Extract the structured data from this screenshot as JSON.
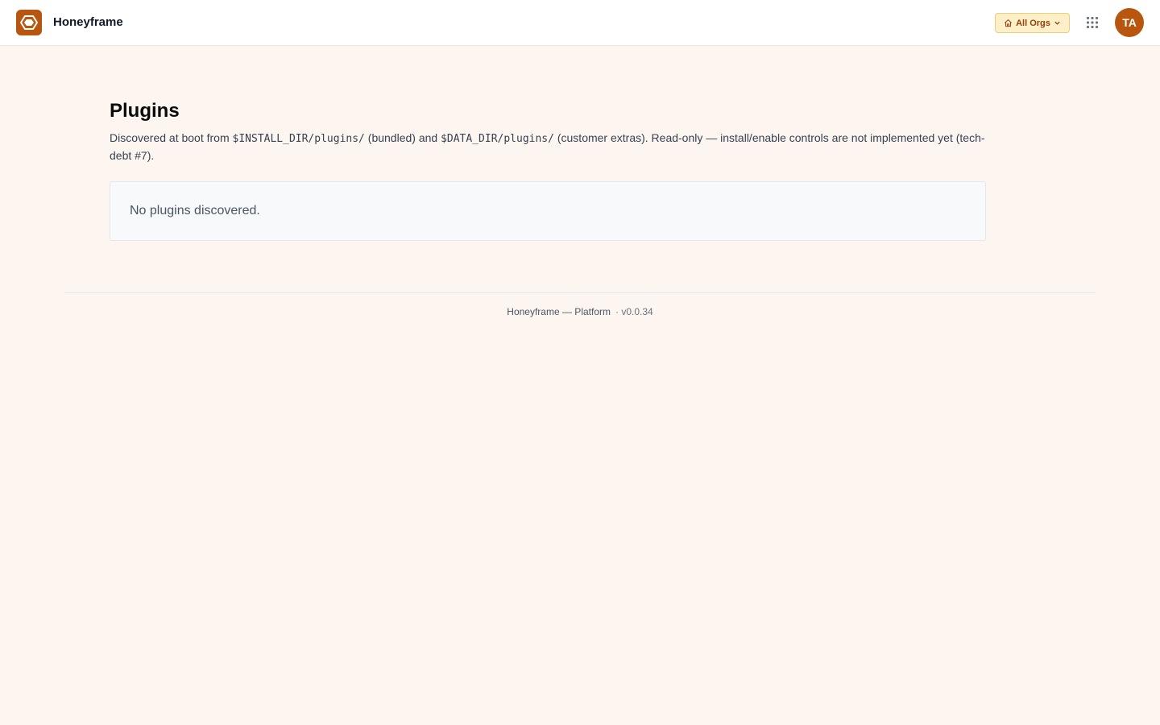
{
  "header": {
    "brand": "Honeyframe",
    "org_switcher": {
      "label": "All Orgs"
    },
    "avatar_initials": "TA"
  },
  "main": {
    "title": "Plugins",
    "description": {
      "part1": "Discovered at boot from ",
      "code1": "$INSTALL_DIR/plugins/",
      "part2": " (bundled) and ",
      "code2": "$DATA_DIR/plugins/",
      "part3": " (customer extras). Read-only — install/enable controls are not implemented yet (tech-debt #7)."
    },
    "empty_state": "No plugins discovered."
  },
  "footer": {
    "product": "Honeyframe — Platform",
    "version": "· v0.0.34"
  },
  "colors": {
    "brand": "#b8550f",
    "page_bg": "#fdf6f0",
    "org_badge_bg": "#fdf0c8",
    "org_badge_text": "#92400e"
  },
  "icons": {
    "logo": "hexagon-logo-icon",
    "org": "building-icon",
    "org_chevron": "chevron-down-icon",
    "apps": "grid-dots-icon"
  }
}
